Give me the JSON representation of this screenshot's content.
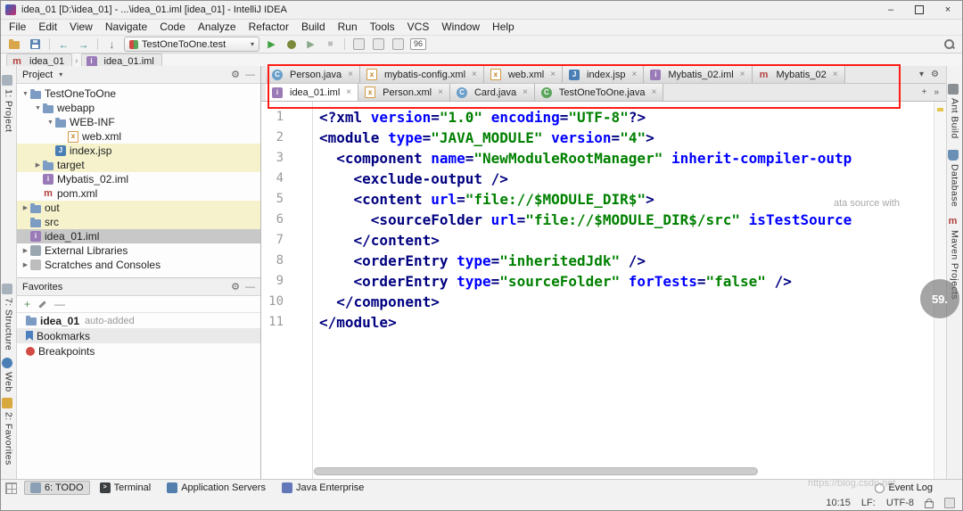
{
  "window": {
    "title": "idea_01 [D:\\idea_01] - ...\\idea_01.iml [idea_01] - IntelliJ IDEA",
    "minimize": "–",
    "maximize": "",
    "close": "×"
  },
  "menu": {
    "items": [
      "File",
      "Edit",
      "View",
      "Navigate",
      "Code",
      "Analyze",
      "Refactor",
      "Build",
      "Run",
      "Tools",
      "VCS",
      "Window",
      "Help"
    ]
  },
  "toolbar": {
    "run_config": "TestOneToOne.test",
    "badge": "96"
  },
  "breadcrumbs": {
    "items": [
      {
        "label": "idea_01",
        "icon": "module"
      },
      {
        "label": "idea_01.iml",
        "icon": "iml"
      }
    ]
  },
  "left_strip": {
    "items": [
      {
        "label": "1: Project",
        "icon": "panel"
      },
      {
        "label": "7: Structure",
        "icon": "panel"
      },
      {
        "label": "Web",
        "icon": "web"
      },
      {
        "label": "2: Favorites",
        "icon": "star"
      }
    ]
  },
  "right_strip": {
    "items": [
      {
        "label": "Ant Build",
        "icon": "ant"
      },
      {
        "label": "Database",
        "icon": "db"
      },
      {
        "label": "Maven Projects",
        "icon": "maven"
      }
    ]
  },
  "project": {
    "title": "Project",
    "tree": [
      {
        "depth": 0,
        "arrow": "▼",
        "icon": "folder",
        "label": "TestOneToOne"
      },
      {
        "depth": 1,
        "arrow": "▼",
        "icon": "folder",
        "label": "webapp"
      },
      {
        "depth": 2,
        "arrow": "▼",
        "icon": "folder",
        "label": "WEB-INF"
      },
      {
        "depth": 3,
        "arrow": "",
        "icon": "xml",
        "label": "web.xml"
      },
      {
        "depth": 2,
        "arrow": "",
        "icon": "jsp",
        "label": "index.jsp",
        "bg": "yellow"
      },
      {
        "depth": 1,
        "arrow": "▶",
        "icon": "folder",
        "label": "target",
        "bg": "yellow"
      },
      {
        "depth": 1,
        "arrow": "",
        "icon": "iml",
        "label": "Mybatis_02.iml"
      },
      {
        "depth": 1,
        "arrow": "",
        "icon": "mvn",
        "label": "pom.xml"
      },
      {
        "depth": 0,
        "arrow": "▶",
        "icon": "folder",
        "label": "out",
        "bg": "yellow"
      },
      {
        "depth": 0,
        "arrow": "",
        "icon": "folder",
        "label": "src",
        "bg": "yellow"
      },
      {
        "depth": 0,
        "arrow": "",
        "icon": "iml",
        "label": "idea_01.iml",
        "selected": true
      },
      {
        "depth": 0,
        "arrow": "▶",
        "icon": "lib",
        "label": "External Libraries"
      },
      {
        "depth": 0,
        "arrow": "▶",
        "icon": "scratch",
        "label": "Scratches and Consoles"
      }
    ]
  },
  "favorites": {
    "title": "Favorites",
    "items": [
      {
        "icon": "folder",
        "label": "idea_01",
        "suffix": "auto-added",
        "bold": true
      },
      {
        "icon": "bookmark",
        "label": "Bookmarks",
        "shade": true
      },
      {
        "icon": "breakpoint",
        "label": "Breakpoints"
      }
    ]
  },
  "editor": {
    "tab_rows": [
      [
        {
          "icon": "class",
          "label": "Person.java",
          "close": "×"
        },
        {
          "icon": "xml",
          "label": "mybatis-config.xml",
          "close": "×"
        },
        {
          "icon": "xml",
          "label": "web.xml",
          "close": "×"
        },
        {
          "icon": "jsp",
          "label": "index.jsp",
          "close": "×"
        },
        {
          "icon": "iml",
          "label": "Mybatis_02.iml",
          "close": "×"
        },
        {
          "icon": "mvn",
          "label": "Mybatis_02",
          "close": "×"
        }
      ],
      [
        {
          "icon": "iml",
          "label": "idea_01.iml",
          "close": "×",
          "active": true
        },
        {
          "icon": "xml",
          "label": "Person.xml",
          "close": "×"
        },
        {
          "icon": "class",
          "label": "Card.java",
          "close": "×"
        },
        {
          "icon": "test",
          "label": "TestOneToOne.java",
          "close": "×"
        }
      ]
    ],
    "code": {
      "lines": [
        {
          "num": 1,
          "segs": [
            [
              "t",
              "<?xml "
            ],
            [
              "a",
              "version"
            ],
            [
              "t",
              "="
            ],
            [
              "v",
              "\"1.0\""
            ],
            [
              "t",
              " "
            ],
            [
              "a",
              "encoding"
            ],
            [
              "t",
              "="
            ],
            [
              "v",
              "\"UTF-8\""
            ],
            [
              "t",
              "?>"
            ]
          ]
        },
        {
          "num": 2,
          "segs": [
            [
              "t",
              "<module "
            ],
            [
              "a",
              "type"
            ],
            [
              "t",
              "="
            ],
            [
              "v",
              "\"JAVA_MODULE\""
            ],
            [
              "t",
              " "
            ],
            [
              "a",
              "version"
            ],
            [
              "t",
              "="
            ],
            [
              "v",
              "\"4\""
            ],
            [
              "t",
              ">"
            ]
          ]
        },
        {
          "num": 3,
          "segs": [
            [
              "t",
              "  <component "
            ],
            [
              "a",
              "name"
            ],
            [
              "t",
              "="
            ],
            [
              "v",
              "\"NewModuleRootManager\""
            ],
            [
              "t",
              " "
            ],
            [
              "a",
              "inherit-compiler-outp"
            ]
          ]
        },
        {
          "num": 4,
          "segs": [
            [
              "t",
              "    <exclude-output />"
            ]
          ]
        },
        {
          "num": 5,
          "segs": [
            [
              "t",
              "    <content "
            ],
            [
              "a",
              "url"
            ],
            [
              "t",
              "="
            ],
            [
              "v",
              "\"file://$MODULE_DIR$\""
            ],
            [
              "t",
              ">"
            ]
          ]
        },
        {
          "num": 6,
          "segs": [
            [
              "t",
              "      <sourceFolder "
            ],
            [
              "a",
              "url"
            ],
            [
              "t",
              "="
            ],
            [
              "v",
              "\"file://$MODULE_DIR$/src\""
            ],
            [
              "t",
              " "
            ],
            [
              "a",
              "isTestSource"
            ]
          ]
        },
        {
          "num": 7,
          "segs": [
            [
              "t",
              "    </content>"
            ]
          ]
        },
        {
          "num": 8,
          "segs": [
            [
              "t",
              "    <orderEntry "
            ],
            [
              "a",
              "type"
            ],
            [
              "t",
              "="
            ],
            [
              "v",
              "\"inheritedJdk\""
            ],
            [
              "t",
              " />"
            ]
          ]
        },
        {
          "num": 9,
          "segs": [
            [
              "t",
              "    <orderEntry "
            ],
            [
              "a",
              "type"
            ],
            [
              "t",
              "="
            ],
            [
              "v",
              "\"sourceFolder\""
            ],
            [
              "t",
              " "
            ],
            [
              "a",
              "forTests"
            ],
            [
              "t",
              "="
            ],
            [
              "v",
              "\"false\""
            ],
            [
              "t",
              " />"
            ]
          ]
        },
        {
          "num": 10,
          "segs": [
            [
              "t",
              "  </component>"
            ]
          ]
        },
        {
          "num": 11,
          "segs": [
            [
              "t",
              "</module>"
            ]
          ]
        }
      ]
    }
  },
  "status": {
    "toolwindows": [
      {
        "label": "6: TODO",
        "icon": "todo",
        "active": true
      },
      {
        "label": "Terminal",
        "icon": "terminal"
      },
      {
        "label": "Application Servers",
        "icon": "appserver"
      },
      {
        "label": "Java Enterprise",
        "icon": "javaee"
      }
    ],
    "event_log": "Event Log",
    "time": "10:15",
    "line_ending": "LF:",
    "encoding": "UTF-8"
  },
  "overlays": {
    "reading_badge": "59.",
    "tooltip_fragment": "ata source with",
    "watermark": "https://blog.csdn.net"
  }
}
